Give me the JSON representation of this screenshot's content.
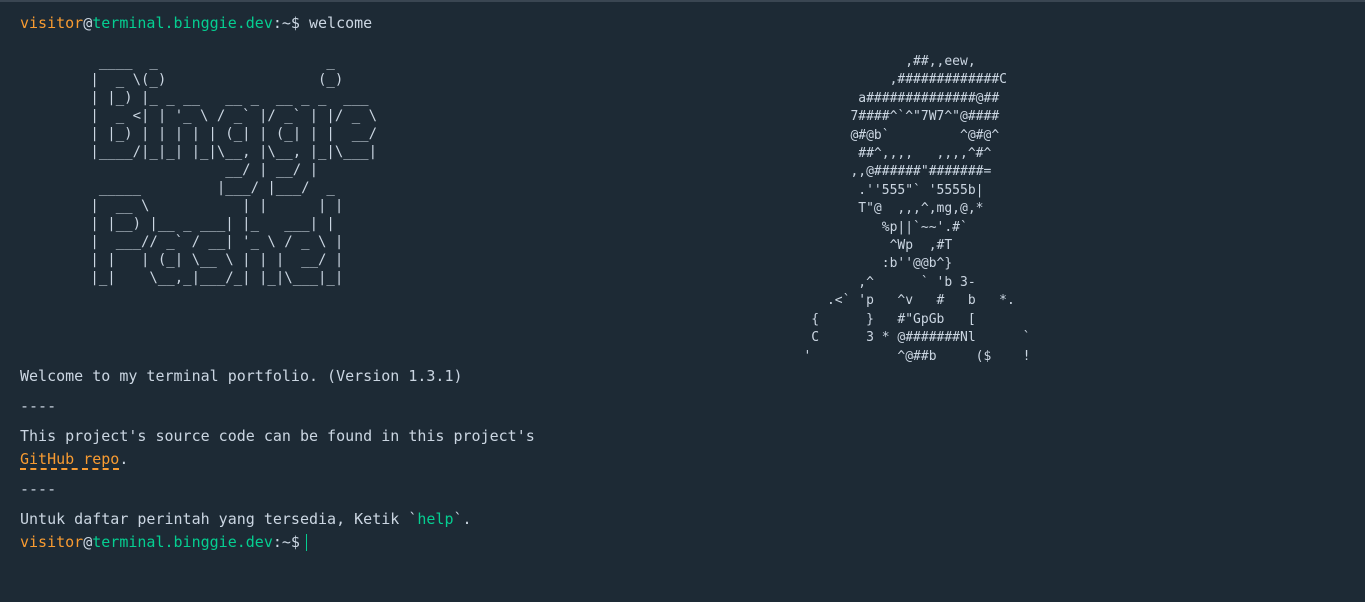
{
  "prompt": {
    "user": "visitor",
    "at": "@",
    "host": "terminal.binggie.dev",
    "path": ":~$"
  },
  "history": {
    "command": "welcome"
  },
  "ascii": {
    "logo": "  ____  _                    _\n |  _ \\(_)                  (_)\n | |_) |_ _ __   __ _  __ _ _  ___\n |  _ <| | '_ \\ / _` |/ _` | |/ _ \\\n | |_) | | | | | (_| | (_| | |  __/\n |____/|_|_| |_|\\__, |\\__, |_|\\___|\n                 __/ | __/ |\n  _____         |___/ |___/  _\n |  __ \\           | |      | |\n | |__) |__ _ ___| |_   ___| |\n |  ___// _` / __| '_ \\ / _ \\ |\n | |   | (_| \\__ \\ | | |  __/ |\n |_|    \\__,_|___/_| |_|\\___|_|",
    "portrait": "                ,##,,eew,\n              ,#############C\n          a##############@##\n         7####^`^\"7W7^\"@####\n         @#@b`         ^@#@^\n          ##^,,,,   ,,,,^#^\n         ,,@######\"#######=\n          .''555\"` '5555b|\n          T\"@  ,,,^,mg,@,*\n             %p||`~~'.#`\n              ^Wp  ,#T\n             :b''@@b^}\n          ,^      ` 'b 3-\n      .<` 'p   ^v   #   b   *.\n    {      }   #\"GpGb   [\n    C      3 * @#######Nl      `\n   '           ^@##b     ($    !"
  },
  "welcome": {
    "line1": "Welcome to my terminal portfolio. (Version 1.3.1)",
    "sep1": "----",
    "line2": "This project's source code can be found in this project's",
    "link_text": "GitHub repo",
    "link_suffix": ".",
    "sep2": "----",
    "help_prefix": "Untuk daftar perintah yang tersedia, Ketik `",
    "help_cmd": "help",
    "help_suffix": "`."
  },
  "input": {
    "value": ""
  },
  "colors": {
    "background": "#1d2a35",
    "text": "#cbd6e2",
    "user": "#f89b31",
    "host": "#05ce91"
  }
}
